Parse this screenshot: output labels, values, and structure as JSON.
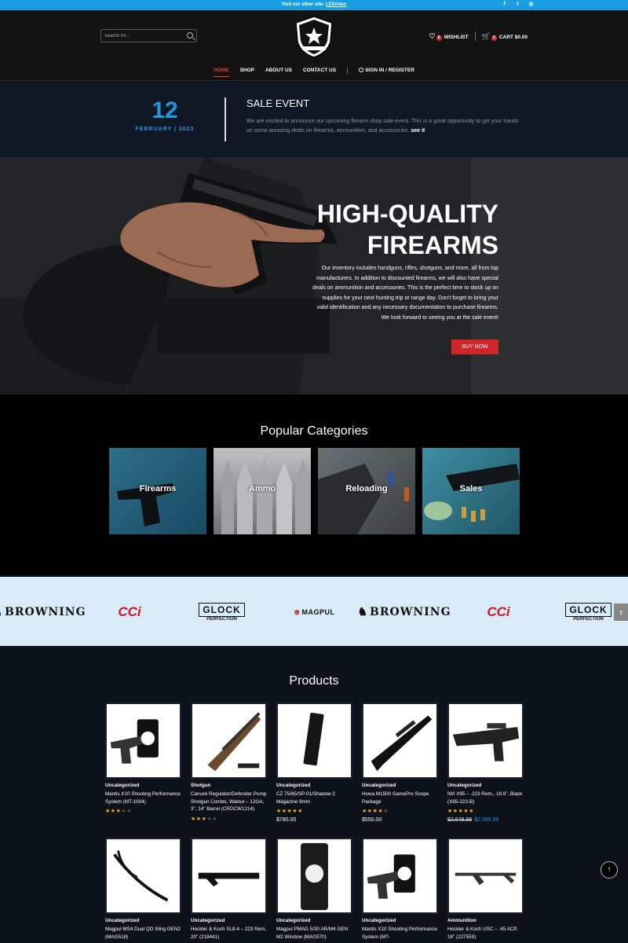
{
  "topbar": {
    "message": "Visit our other site:",
    "link": "LEDriven",
    "social": [
      "facebook-icon",
      "twitter-icon",
      "instagram-icon"
    ]
  },
  "header": {
    "search_placeholder": "Search for...",
    "wishlist_label": "WISHLIST",
    "wishlist_count": "0",
    "cart_label": "CART",
    "cart_count": "0",
    "cart_total": "$0.00",
    "nav": [
      {
        "label": "HOME",
        "active": true
      },
      {
        "label": "SHOP"
      },
      {
        "label": "ABOUT US"
      },
      {
        "label": "CONTACT US"
      }
    ],
    "signin": "SIGN IN / REGISTER"
  },
  "sale": {
    "day": "12",
    "month": "FEBRUARY | 2023",
    "title": "SALE EVENT",
    "desc": "We are excited to announce our upcoming firearm shop sale event. This is a great opportunity to get your hands on some amazing deals on firearms, ammunition, and accessories.",
    "link": "see it"
  },
  "hero": {
    "title_line1": "HIGH-QUALITY",
    "title_line2": "FIREARMS",
    "text": "Our inventory includes handguns, rifles, shotguns, and more, all from top manufacturers. In addition to discounted firearms, we will also have special deals on ammunition and accessories. This is the perfect time to stock up on supplies for your next hunting trip or range day. Don't forget to bring your valid identification and any necessary documentation to purchase firearms. We look forward to seeing you at the sale event!",
    "button": "BUY NOW"
  },
  "categories": {
    "heading": "Popular Categories",
    "items": [
      "Firearms",
      "Ammo",
      "Reloading",
      "Sales"
    ]
  },
  "brands": [
    {
      "name": "BROWNING"
    },
    {
      "name": "CCi"
    },
    {
      "name": "GLOCK",
      "sub": "PERFECTION"
    },
    {
      "name": "MAGPUL"
    }
  ],
  "products": {
    "heading": "Products",
    "items": [
      {
        "category": "Uncategorized",
        "name": "Mantis X10 Shooting Performance System (MT-1004)",
        "rating": 2.5
      },
      {
        "category": "Shotgun",
        "name": "Canuck Regulator/Defender Pump Shotgun Combo, Walnut – 12GA, 3\", 14\" Barrel (CRDCW1214)",
        "rating": 3
      },
      {
        "category": "Uncategorized",
        "name": "CZ 75/85/SP-01/Shadow 2 Magazine 9mm",
        "rating": 5,
        "price": "$780.00"
      },
      {
        "category": "Uncategorized",
        "name": "Howa M1500 GamePro Scope Package",
        "rating": 4,
        "price": "$550.00"
      },
      {
        "category": "Uncategorized",
        "name": "IWI X95 – .223 Rem., 18.6\", Black (X95-223-B)",
        "rating": 5,
        "old_price": "$2,649.99",
        "price": "$2,599.99"
      },
      {
        "category": "Uncategorized",
        "name": "Magpul MS4 Dual QD Sling GEN2 (MAG518)"
      },
      {
        "category": "Uncategorized",
        "name": "Heckler & Koch SL8-4 – 223 Rem, 20\" (218441)"
      },
      {
        "category": "Uncategorized",
        "name": "Magpul PMAG 5/30 AR/M4 GEN M2 Window (MAG570)"
      },
      {
        "category": "Uncategorized",
        "name": "Mantis X10 Shooting Performance System (MT-"
      },
      {
        "category": "Ammunition",
        "name": "Heckler & Koch USC – .45 ACP, 16\" (227559)"
      }
    ]
  },
  "colors": {
    "accent": "#1f96e0",
    "red": "#d3232b",
    "star": "#f2b01e"
  }
}
